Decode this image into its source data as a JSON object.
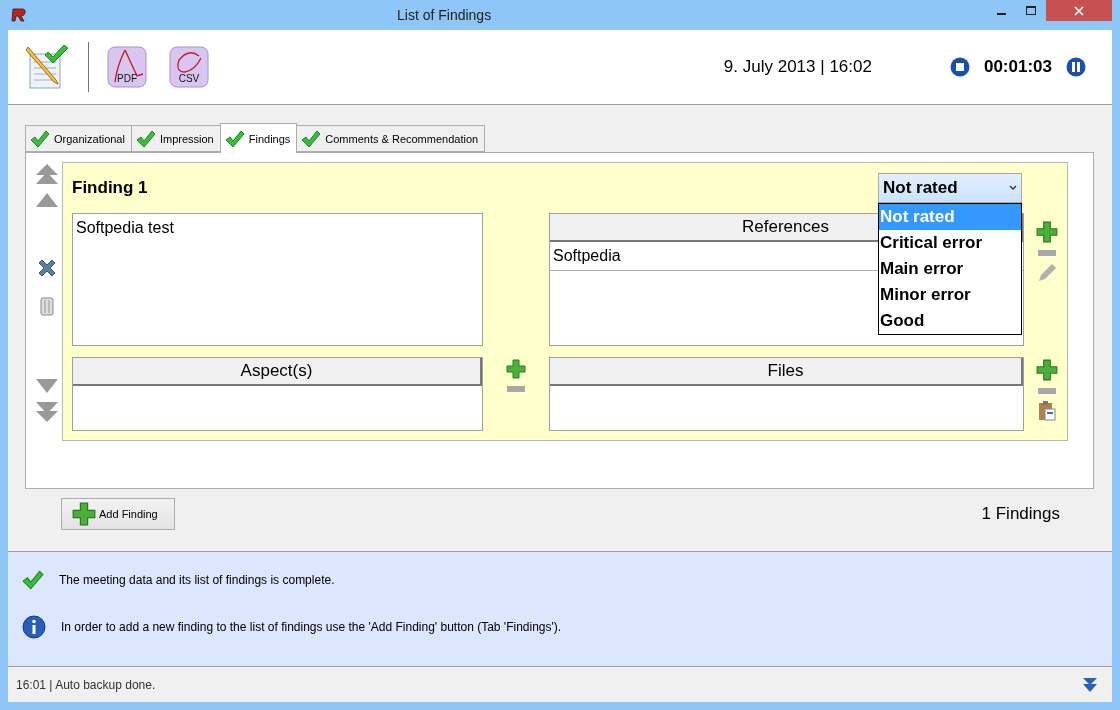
{
  "window": {
    "title": "List of Findings"
  },
  "toolbar": {
    "export_buttons": [
      {
        "label": "PDF"
      },
      {
        "label": "CSV"
      }
    ],
    "date": "9. July 2013 | 16:02",
    "timer": "00:01:03"
  },
  "tabs": [
    {
      "label": "Organizational",
      "selected": false
    },
    {
      "label": "Impression",
      "selected": false
    },
    {
      "label": "Findings",
      "selected": true
    },
    {
      "label": "Comments & Recommendation",
      "selected": false
    }
  ],
  "finding": {
    "title": "Finding 1",
    "text": "Softpedia test",
    "rating": {
      "value": "Not rated",
      "expanded": true,
      "options": [
        {
          "label": "Not rated",
          "selected": true
        },
        {
          "label": "Critical error",
          "selected": false
        },
        {
          "label": "Main error",
          "selected": false
        },
        {
          "label": "Minor error",
          "selected": false
        },
        {
          "label": "Good",
          "selected": false
        }
      ]
    },
    "references": {
      "header": "References",
      "rows": [
        "Softpedia"
      ]
    },
    "aspects": {
      "header": "Aspect(s)"
    },
    "files": {
      "header": "Files"
    }
  },
  "add_button": "Add Finding",
  "count": "1 Findings",
  "messages": [
    {
      "kind": "success",
      "text": "The meeting data and its list of findings is complete."
    },
    {
      "kind": "info",
      "text": "In order to add a new finding to the list of findings use the 'Add Finding' button (Tab 'Findings')."
    }
  ],
  "status_bar": {
    "text": "16:01 | Auto backup done."
  }
}
